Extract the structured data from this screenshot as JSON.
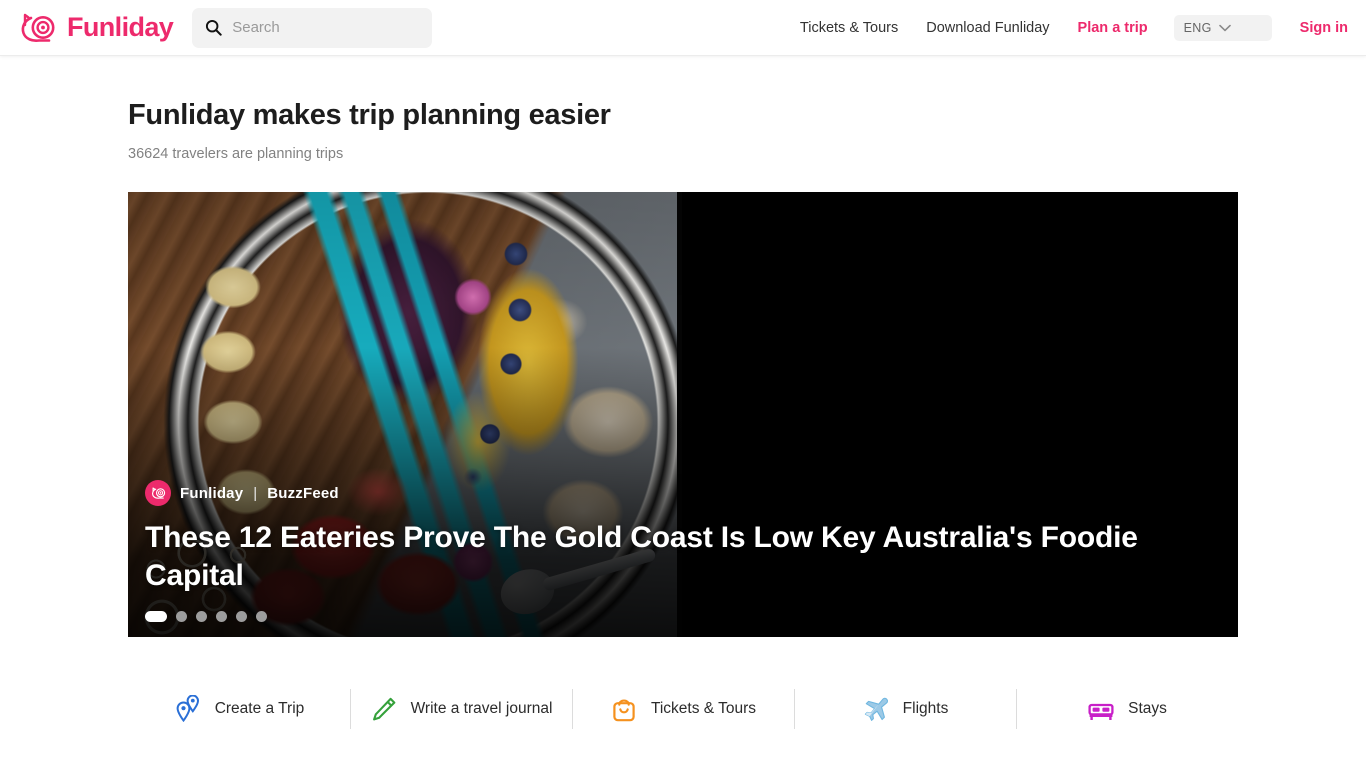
{
  "brand": {
    "name": "Funliday",
    "logo_icon": "funliday-snail-logo",
    "color": "#ED2A6C"
  },
  "search": {
    "placeholder": "Search",
    "value": "",
    "icon": "search-icon"
  },
  "nav": {
    "links": [
      {
        "label": "Tickets & Tours",
        "style": "plain"
      },
      {
        "label": "Download Funliday",
        "style": "plain"
      },
      {
        "label": "Plan a trip",
        "style": "accent"
      }
    ],
    "language": {
      "label": "ENG",
      "icon": "chevron-down-icon"
    },
    "signin": "Sign in"
  },
  "hero": {
    "title": "Funliday makes trip planning easier",
    "subtitle": "36624 travelers are planning trips"
  },
  "carousel": {
    "source_name": "Funliday",
    "separator": "|",
    "publisher": "BuzzFeed",
    "badge_icon": "funliday-badge-icon",
    "title": "These 12 Eateries Prove The Gold Coast Is Low Key Australia's Foodie Capital",
    "slide_count": 6,
    "active_slide": 1
  },
  "actions": [
    {
      "label": "Create a Trip",
      "icon": "map-pins-icon",
      "color": "#2A6FD6"
    },
    {
      "label": "Write a travel journal",
      "icon": "pencil-icon",
      "color": "#35A13B"
    },
    {
      "label": "Tickets & Tours",
      "icon": "shopping-bag-icon",
      "color": "#F5911E"
    },
    {
      "label": "Flights",
      "icon": "airplane-icon",
      "color": "#6FB7E0"
    },
    {
      "label": "Stays",
      "icon": "bed-icon",
      "color": "#C81FC8"
    }
  ]
}
